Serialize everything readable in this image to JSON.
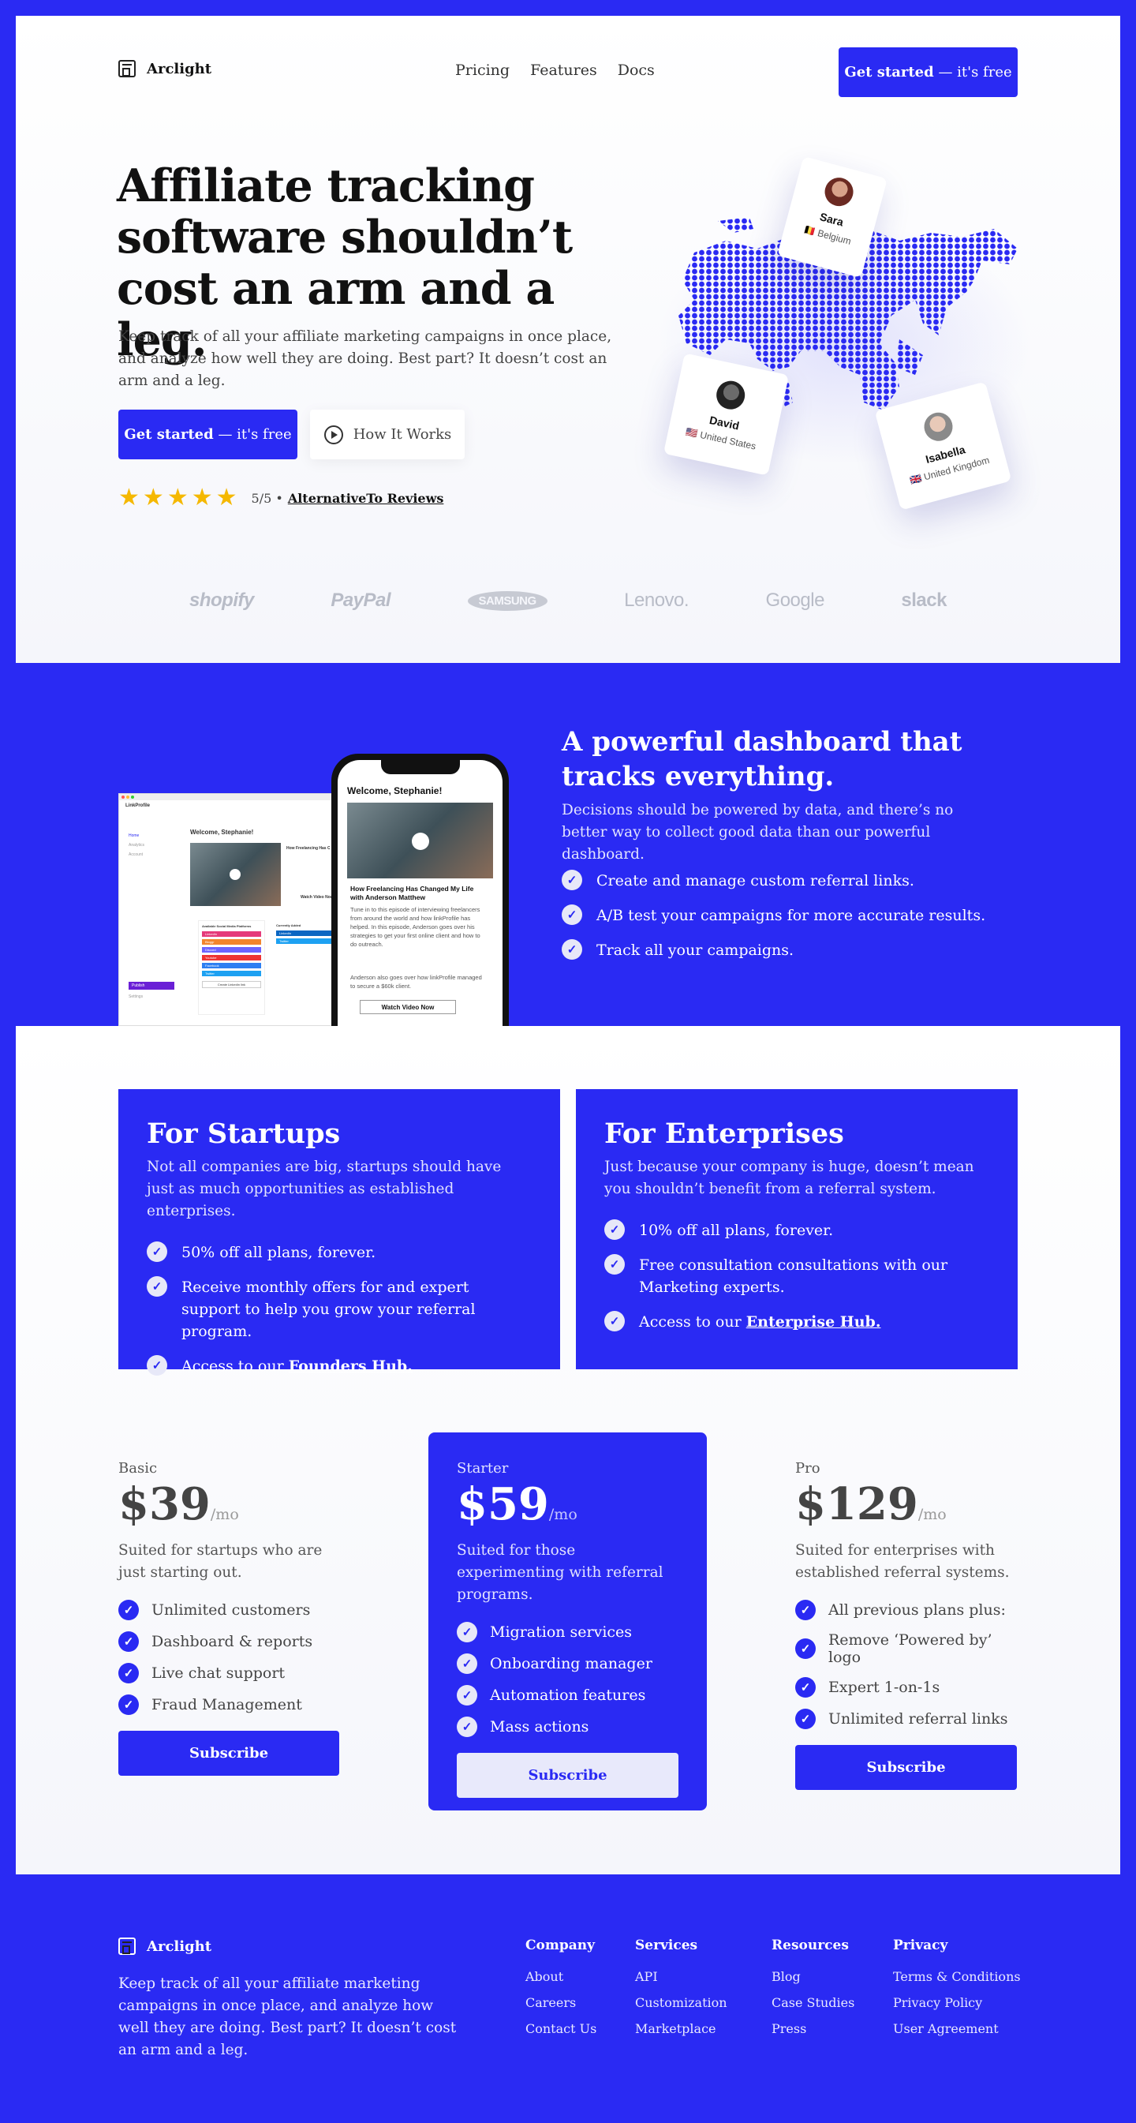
{
  "header": {
    "brand": "Arclight",
    "nav": [
      "Pricing",
      "Features",
      "Docs"
    ],
    "cta_bold": "Get started",
    "cta_rest": " — it's free"
  },
  "hero": {
    "title": "Affiliate tracking software shouldn’t cost an arm and a leg.",
    "subtitle": "Keep track of all your affiliate marketing campaigns in once place, and analyze how well they are doing. Best part? It doesn’t cost an arm and a leg.",
    "cta_bold": "Get started",
    "cta_rest": " — it's free",
    "how_label": "How It Works",
    "rating": "5/5 •",
    "rating_link": "AlternativeTo Reviews",
    "stars": 5
  },
  "map_profiles": [
    {
      "name": "Sara",
      "country": "Belgium",
      "flag": "🇧🇪"
    },
    {
      "name": "David",
      "country": "United States",
      "flag": "🇺🇸"
    },
    {
      "name": "Isabella",
      "country": "United Kingdom",
      "flag": "🇬🇧"
    }
  ],
  "logos": [
    "shopify",
    "PayPal",
    "SAMSUNG",
    "Lenovo.",
    "Google",
    "slack"
  ],
  "dashboard": {
    "title": "A powerful dashboard that tracks everything.",
    "subtitle": "Decisions should be powered by data, and there’s no better way to collect good data than our powerful dashboard.",
    "features": [
      "Create and manage custom referral links.",
      "A/B test your campaigns for more accurate results.",
      "Track all your campaigns."
    ],
    "desktop_greeting": "Welcome, Stephanie!",
    "app_name": "LinkProfile",
    "desktop_sidebar": [
      "Home",
      "Analytics",
      "Account",
      "Publish",
      "Settings"
    ],
    "desktop_article_title": "How Freelancing Has C",
    "desktop_watch": "Watch Video Now",
    "desktop_block_title": "Available Social Media Platforms",
    "desktop_block_title2": "Currently Added",
    "desktop_platforms": [
      "LinkedIn",
      "Bloggr",
      "Discord",
      "Youtube",
      "Facebook",
      "Twitter"
    ],
    "desktop_added": [
      "LinkedIn",
      "Twitter"
    ],
    "desktop_create": "Create Linkedin link",
    "phone_greeting": "Welcome, Stephanie!",
    "phone_article_title": "How Freelancing Has Changed My Life with Anderson Matthew",
    "phone_article_body": "Tune in to this episode of interviewing freelancers from around the world and how linkProfile has helped. In this episode, Anderson goes over his strategies to get your first online client and how to do outreach.",
    "phone_article_body2": "Anderson also goes over how linkProfile managed to secure a $60k client.",
    "phone_watch": "Watch Video Now"
  },
  "segments": [
    {
      "title": "For Startups",
      "subtitle": "Not all companies are big, startups should have just as much opportunities as established enterprises.",
      "items": [
        "50% off all plans, forever.",
        "Receive monthly offers for and expert support to help you grow your referral program."
      ],
      "access_prefix": "Access to our ",
      "access_link": "Founders Hub."
    },
    {
      "title": "For Enterprises",
      "subtitle": "Just because your company is huge, doesn’t mean you shouldn’t benefit from a referral system.",
      "items": [
        "10% off all plans, forever.",
        "Free consultation consultations with our Marketing experts."
      ],
      "access_prefix": "Access to our ",
      "access_link": "Enterprise Hub."
    }
  ],
  "plans": [
    {
      "name": "Basic",
      "price": "$39",
      "per": "/mo",
      "desc": "Suited for startups who are just starting out.",
      "features": [
        "Unlimited customers",
        "Dashboard & reports",
        "Live chat support",
        "Fraud Management"
      ],
      "button": "Subscribe"
    },
    {
      "name": "Starter",
      "price": "$59",
      "per": "/mo",
      "desc": "Suited for those experimenting with referral programs.",
      "features": [
        "Migration services",
        "Onboarding manager",
        "Automation features",
        "Mass actions"
      ],
      "button": "Subscribe"
    },
    {
      "name": "Pro",
      "price": "$129",
      "per": "/mo",
      "desc": "Suited for enterprises with established referral systems.",
      "features": [
        "All previous plans plus:",
        "Remove ‘Powered by’ logo",
        "Expert 1-on-1s",
        "Unlimited referral links"
      ],
      "button": "Subscribe"
    }
  ],
  "footer": {
    "brand": "Arclight",
    "tagline": "Keep track of all your affiliate marketing campaigns in once place, and analyze how well they are doing. Best part? It doesn’t cost an arm and a leg.",
    "columns": [
      {
        "title": "Company",
        "links": [
          "About",
          "Careers",
          "Contact Us"
        ]
      },
      {
        "title": "Services",
        "links": [
          "API",
          "Customization",
          "Marketplace"
        ]
      },
      {
        "title": "Resources",
        "links": [
          "Blog",
          "Case Studies",
          "Press"
        ]
      },
      {
        "title": "Privacy",
        "links": [
          "Terms & Conditions",
          "Privacy Policy",
          "User Agreement"
        ]
      }
    ]
  },
  "colors": {
    "brand_blue": "#2a2af3",
    "star": "#f5b800",
    "text_dark": "#111111"
  }
}
